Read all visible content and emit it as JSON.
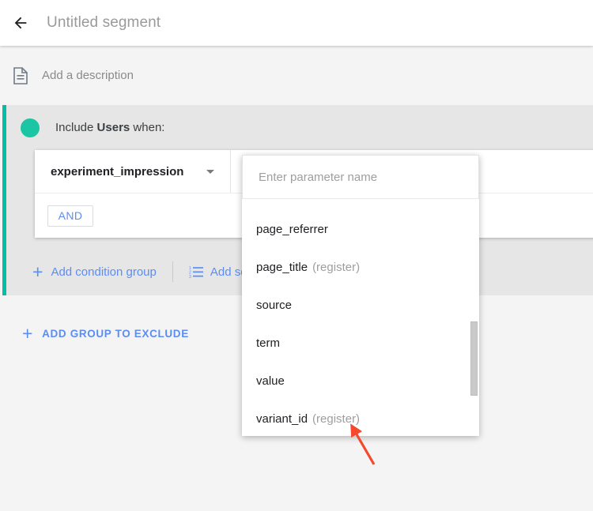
{
  "topbar": {
    "back_icon": "arrow-left-icon",
    "title": "Untitled segment"
  },
  "description": {
    "icon": "document-icon",
    "placeholder": "Add a description"
  },
  "condition_block": {
    "accent_color": "#00bfa5",
    "dot_color": "#1cc5a3",
    "include_prefix": "Include",
    "include_scope": "Users",
    "include_suffix": "when:",
    "dimension": {
      "label": "experiment_impression",
      "caret_icon": "chevron-down-icon"
    },
    "and_button": "AND",
    "links": [
      {
        "icon": "plus-icon",
        "label": "Add condition group"
      },
      {
        "icon": "numbered-list-icon",
        "label": "Add sequ"
      }
    ]
  },
  "exclude": {
    "icon": "plus-icon",
    "label": "ADD GROUP TO EXCLUDE"
  },
  "param_dropdown": {
    "input_value": "",
    "input_placeholder": "Enter parameter name",
    "items": [
      {
        "name": "page_referrer",
        "hint": ""
      },
      {
        "name": "page_title",
        "hint": "(register)"
      },
      {
        "name": "source",
        "hint": ""
      },
      {
        "name": "term",
        "hint": ""
      },
      {
        "name": "value",
        "hint": ""
      },
      {
        "name": "variant_id",
        "hint": "(register)"
      }
    ]
  },
  "annotation": {
    "arrow_color": "#f4492d",
    "points_to": "variant_id"
  }
}
